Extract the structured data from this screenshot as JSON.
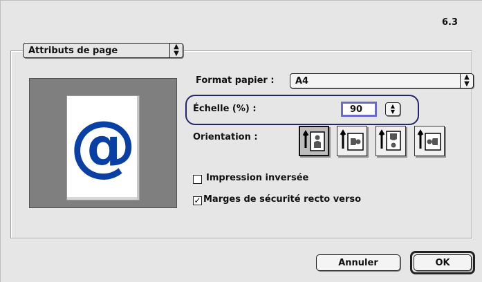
{
  "version": "6.3",
  "section_popup": {
    "label": "Attributs de page",
    "arrows": "⇕"
  },
  "paper_format": {
    "label": "Format papier :",
    "value": "A4"
  },
  "scale": {
    "label": "Échelle (%) :",
    "value": "90"
  },
  "orientation": {
    "label": "Orientation :",
    "options": [
      {
        "name": "portrait",
        "selected": true
      },
      {
        "name": "landscape",
        "selected": false
      },
      {
        "name": "portrait-reversed",
        "selected": false
      },
      {
        "name": "landscape-reversed",
        "selected": false
      }
    ]
  },
  "options": {
    "reverse_print": {
      "label": "Impression inversée",
      "checked": false
    },
    "duplex_margins": {
      "label": "Marges de sécurité recto verso",
      "checked": true
    }
  },
  "preview": {
    "glyph": "@",
    "glyph_color": "#0a3fa3"
  },
  "buttons": {
    "cancel": "Annuler",
    "ok": "OK"
  },
  "colors": {
    "highlight_oval": "#22276b",
    "scale_field_border": "#6a6ac8"
  }
}
